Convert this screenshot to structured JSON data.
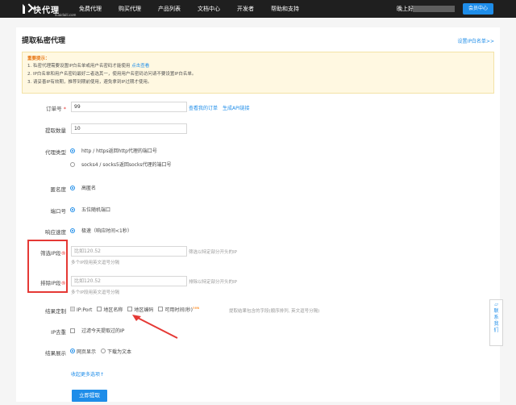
{
  "header": {
    "logo_text": "快代理",
    "logo_sub": "kuaidaili.com",
    "nav": [
      "免费代理",
      "购买代理",
      "产品列表",
      "文档中心",
      "开发者",
      "帮助和支持"
    ],
    "user_greeting": "晚上好",
    "member_button": "会员中心"
  },
  "page": {
    "title": "提取私密代理",
    "whitelist_link": "设置IP白名单>>"
  },
  "notice": {
    "title": "重要提示：",
    "lines": [
      "1. 私密代理需要设置IP白名单或用户名密码才能使用",
      "2. IP白名单和用户名密码最好二者选其一，使用用户名密码访问请不要设置IP白名单。",
      "3. 请妥善IP有效期，推荐到期前使用，避免拿到IP过期才使用。"
    ],
    "link": "点击查看"
  },
  "form": {
    "order_label": "订单号",
    "order_value": "99",
    "order_view": "查看我的订单",
    "api_link": "生成API链接",
    "count_label": "提取数量",
    "count_value": "10",
    "proxy_type_label": "代理类型",
    "proxy_types": [
      "http / https返回http代理的端口号",
      "socks4 / socks5返回socks代理的端口号"
    ],
    "anonymity_label": "匿名度",
    "anonymity_value": "高匿名",
    "port_label": "端口号",
    "port_value": "五位随机端口",
    "speed_label": "响应速度",
    "speed_value": "极速（响应时间<1秒）",
    "filter_label": "筛选IP段",
    "filter_placeholder": "比如120.52",
    "filter_hint": "筛选以特定部分开头的IP",
    "filter_sub": "多个IP段用英文逗号分隔",
    "exclude_label": "排除IP段",
    "exclude_placeholder": "比如120.52",
    "exclude_hint": "排除以特定部分开头的IP",
    "exclude_sub": "多个IP段用英文逗号分隔",
    "result_label": "结果定制",
    "result_options": [
      "IP:Port",
      "地区名称",
      "地区编码",
      "可用时间(秒)"
    ],
    "result_new": "new",
    "result_hint": "提取结果包含的字段(顺序排列, 英文逗号分隔)",
    "dedupe_label": "IP去重",
    "dedupe_option": "过滤今天提取过的IP",
    "display_label": "结果展示",
    "display_options": [
      "网页显示",
      "下载为文本"
    ],
    "more_options": "收起更多选项↑",
    "submit": "立即提取"
  },
  "side": {
    "contact": [
      "联",
      "系",
      "我",
      "们"
    ]
  }
}
